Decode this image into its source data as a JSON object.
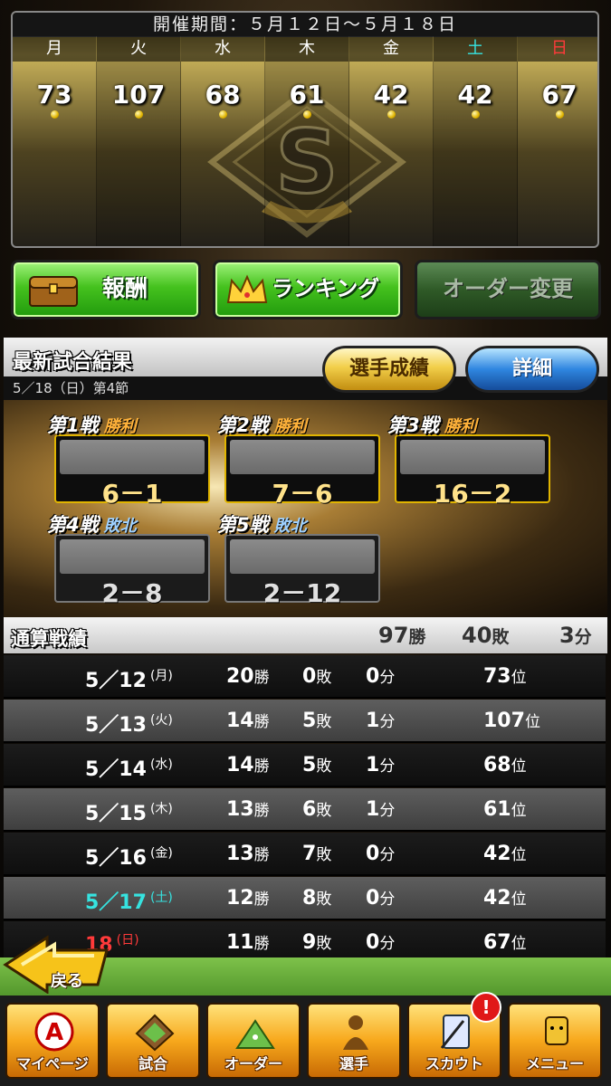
{
  "period": "開催期間：５月１２日～５月１８日",
  "week_rank": [
    {
      "day": "月",
      "rank": "73",
      "color": "#ffffff"
    },
    {
      "day": "火",
      "rank": "107",
      "color": "#ffffff"
    },
    {
      "day": "水",
      "rank": "68",
      "color": "#ffffff"
    },
    {
      "day": "木",
      "rank": "61",
      "color": "#ffffff"
    },
    {
      "day": "金",
      "rank": "42",
      "color": "#ffffff"
    },
    {
      "day": "土",
      "rank": "42",
      "color": "#36e3e0"
    },
    {
      "day": "日",
      "rank": "67",
      "color": "#ff3a3a"
    }
  ],
  "emblem_letter": "S",
  "buttons": {
    "reward": "報酬",
    "ranking": "ランキング",
    "order_change": "オーダー変更"
  },
  "latest": {
    "title": "最新試合結果",
    "subtitle": "5／18（日）第4節",
    "player_stats": "選手成績",
    "detail": "詳細",
    "games": [
      {
        "label": "第1戦",
        "result": "勝利",
        "score": "6－1",
        "won": true
      },
      {
        "label": "第2戦",
        "result": "勝利",
        "score": "7－6",
        "won": true
      },
      {
        "label": "第3戦",
        "result": "勝利",
        "score": "16－2",
        "won": true
      },
      {
        "label": "第4戦",
        "result": "敗北",
        "score": "2－8",
        "won": false
      },
      {
        "label": "第5戦",
        "result": "敗北",
        "score": "2－12",
        "won": false
      }
    ]
  },
  "totals": {
    "title": "通算戦績",
    "wins": "97",
    "wins_unit": "勝",
    "losses": "40",
    "losses_unit": "敗",
    "draws": "3",
    "draws_unit": "分"
  },
  "history": [
    {
      "date": "5／12",
      "dow": "(月)",
      "w": "20",
      "l": "0",
      "d": "0",
      "rank": "73",
      "style": "normal"
    },
    {
      "date": "5／13",
      "dow": "(火)",
      "w": "14",
      "l": "5",
      "d": "1",
      "rank": "107",
      "style": "normal"
    },
    {
      "date": "5／14",
      "dow": "(水)",
      "w": "14",
      "l": "5",
      "d": "1",
      "rank": "68",
      "style": "normal"
    },
    {
      "date": "5／15",
      "dow": "(木)",
      "w": "13",
      "l": "6",
      "d": "1",
      "rank": "61",
      "style": "normal"
    },
    {
      "date": "5／16",
      "dow": "(金)",
      "w": "13",
      "l": "7",
      "d": "0",
      "rank": "42",
      "style": "normal"
    },
    {
      "date": "5／17",
      "dow": "(土)",
      "w": "12",
      "l": "8",
      "d": "0",
      "rank": "42",
      "style": "cyan"
    },
    {
      "date": "18",
      "dow": "(日)",
      "w": "11",
      "l": "9",
      "d": "0",
      "rank": "67",
      "style": "red"
    }
  ],
  "units": {
    "win": "勝",
    "loss": "敗",
    "draw": "分",
    "rank": "位"
  },
  "back": "戻る",
  "nav": [
    {
      "label": "マイページ",
      "icon": "my-page-icon"
    },
    {
      "label": "試合",
      "icon": "stadium-icon"
    },
    {
      "label": "オーダー",
      "icon": "field-order-icon"
    },
    {
      "label": "選手",
      "icon": "player-icon"
    },
    {
      "label": "スカウト",
      "icon": "scout-card-icon"
    },
    {
      "label": "メニュー",
      "icon": "menu-character-icon"
    }
  ],
  "scout_badge": "!"
}
